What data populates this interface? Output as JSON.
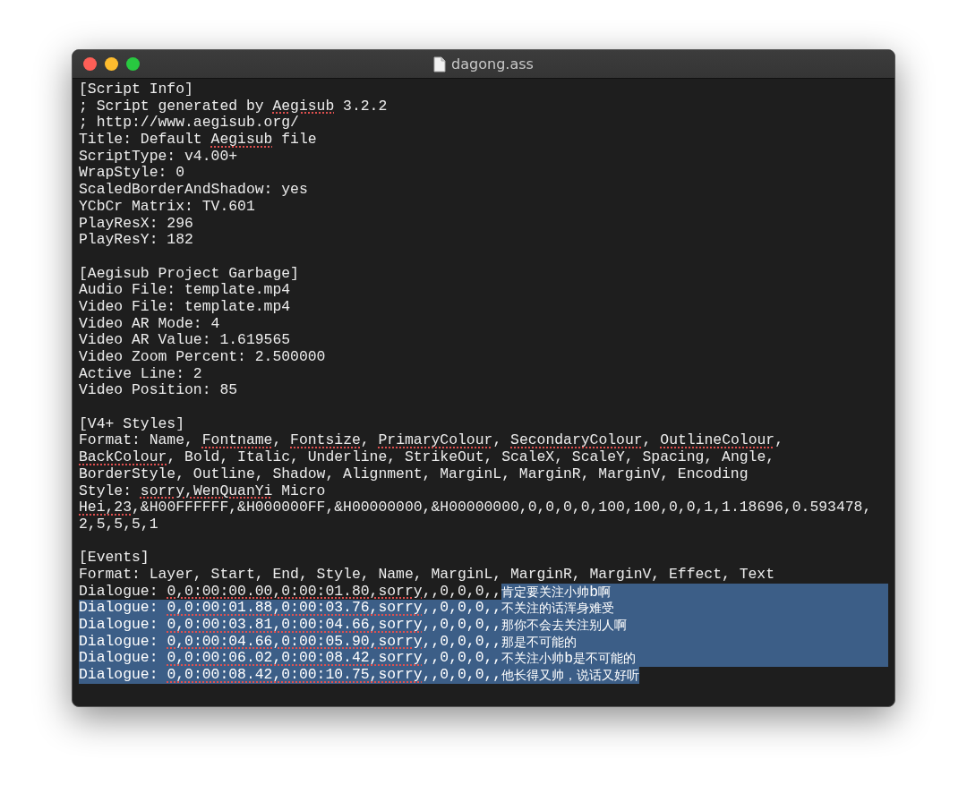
{
  "window": {
    "title": "dagong.ass"
  },
  "lines": [
    {
      "kind": "plain",
      "text": "[Script Info]"
    },
    {
      "kind": "checked",
      "parts": [
        {
          "text": "; Script generated by ",
          "misspelled": false
        },
        {
          "text": "Aegisub",
          "misspelled": true
        },
        {
          "text": " 3.2.2",
          "misspelled": false
        }
      ]
    },
    {
      "kind": "plain",
      "text": "; http://www.aegisub.org/"
    },
    {
      "kind": "checked",
      "parts": [
        {
          "text": "Title: Default ",
          "misspelled": false
        },
        {
          "text": "Aegisub",
          "misspelled": true
        },
        {
          "text": " file",
          "misspelled": false
        }
      ]
    },
    {
      "kind": "plain",
      "text": "ScriptType: v4.00+"
    },
    {
      "kind": "plain",
      "text": "WrapStyle: 0"
    },
    {
      "kind": "plain",
      "text": "ScaledBorderAndShadow: yes"
    },
    {
      "kind": "plain",
      "text": "YCbCr Matrix: TV.601"
    },
    {
      "kind": "plain",
      "text": "PlayResX: 296"
    },
    {
      "kind": "plain",
      "text": "PlayResY: 182"
    },
    {
      "kind": "blank"
    },
    {
      "kind": "plain",
      "text": "[Aegisub Project Garbage]"
    },
    {
      "kind": "plain",
      "text": "Audio File: template.mp4"
    },
    {
      "kind": "plain",
      "text": "Video File: template.mp4"
    },
    {
      "kind": "plain",
      "text": "Video AR Mode: 4"
    },
    {
      "kind": "plain",
      "text": "Video AR Value: 1.619565"
    },
    {
      "kind": "plain",
      "text": "Video Zoom Percent: 2.500000"
    },
    {
      "kind": "plain",
      "text": "Active Line: 2"
    },
    {
      "kind": "plain",
      "text": "Video Position: 85"
    },
    {
      "kind": "blank"
    },
    {
      "kind": "plain",
      "text": "[V4+ Styles]"
    },
    {
      "kind": "checked",
      "parts": [
        {
          "text": "Format: Name, ",
          "misspelled": false
        },
        {
          "text": "Fontname",
          "misspelled": true
        },
        {
          "text": ", ",
          "misspelled": false
        },
        {
          "text": "Fontsize",
          "misspelled": true
        },
        {
          "text": ", ",
          "misspelled": false
        },
        {
          "text": "PrimaryColour",
          "misspelled": true
        },
        {
          "text": ", ",
          "misspelled": false
        },
        {
          "text": "SecondaryColour",
          "misspelled": true
        },
        {
          "text": ", ",
          "misspelled": false
        },
        {
          "text": "OutlineColour",
          "misspelled": true
        },
        {
          "text": ",",
          "misspelled": false
        }
      ]
    },
    {
      "kind": "checked",
      "parts": [
        {
          "text": "BackColour",
          "misspelled": true
        },
        {
          "text": ", Bold, Italic, Underline, StrikeOut, ScaleX, ScaleY, Spacing, Angle,",
          "misspelled": false
        }
      ]
    },
    {
      "kind": "plain",
      "text": "BorderStyle, Outline, Shadow, Alignment, MarginL, MarginR, MarginV, Encoding"
    },
    {
      "kind": "checked",
      "parts": [
        {
          "text": "Style: ",
          "misspelled": false
        },
        {
          "text": "sorry,WenQuanYi",
          "misspelled": true
        },
        {
          "text": " Micro",
          "misspelled": false
        }
      ]
    },
    {
      "kind": "checked",
      "parts": [
        {
          "text": "Hei,23",
          "misspelled": true
        },
        {
          "text": ",&H00FFFFFF,&H000000FF,&H00000000,&H00000000,0,0,0,0,100,100,0,0,1,1.18696,0.593478,",
          "misspelled": false
        }
      ]
    },
    {
      "kind": "plain",
      "text": "2,5,5,5,1"
    },
    {
      "kind": "blank"
    },
    {
      "kind": "plain",
      "text": "[Events]"
    },
    {
      "kind": "plain",
      "text": "Format: Layer, Start, End, Style, Name, MarginL, MarginR, MarginV, Effect, Text"
    },
    {
      "kind": "dialogue",
      "label": "Dialogue: ",
      "timing": "0,0:00:00.00,0:00:01.80,sorry",
      "fields": ",,0,0,0,,",
      "text": "肯定要关注小帅b啊",
      "head_selected": false,
      "text_selected": true,
      "eol_selected": true
    },
    {
      "kind": "dialogue",
      "label": "Dialogue: ",
      "timing": "0,0:00:01.88,0:00:03.76,sorry",
      "fields": ",,0,0,0,,",
      "text": "不关注的话浑身难受",
      "head_selected": true,
      "text_selected": true,
      "eol_selected": true
    },
    {
      "kind": "dialogue",
      "label": "Dialogue: ",
      "timing": "0,0:00:03.81,0:00:04.66,sorry",
      "fields": ",,0,0,0,,",
      "text": "那你不会去关注别人啊",
      "head_selected": true,
      "text_selected": true,
      "eol_selected": true
    },
    {
      "kind": "dialogue",
      "label": "Dialogue: ",
      "timing": "0,0:00:04.66,0:00:05.90,sorry",
      "fields": ",,0,0,0,,",
      "text": "那是不可能的",
      "head_selected": true,
      "text_selected": true,
      "eol_selected": true
    },
    {
      "kind": "dialogue",
      "label": "Dialogue: ",
      "timing": "0,0:00:06.02,0:00:08.42,sorry",
      "fields": ",,0,0,0,,",
      "text": "不关注小帅b是不可能的",
      "head_selected": true,
      "text_selected": true,
      "eol_selected": true
    },
    {
      "kind": "dialogue",
      "label": "Dialogue: ",
      "timing": "0,0:00:08.42,0:00:10.75,sorry",
      "fields": ",,0,0,0,,",
      "text": "他长得又帅，说话又好听",
      "head_selected": true,
      "text_selected": true,
      "eol_selected": false
    }
  ]
}
